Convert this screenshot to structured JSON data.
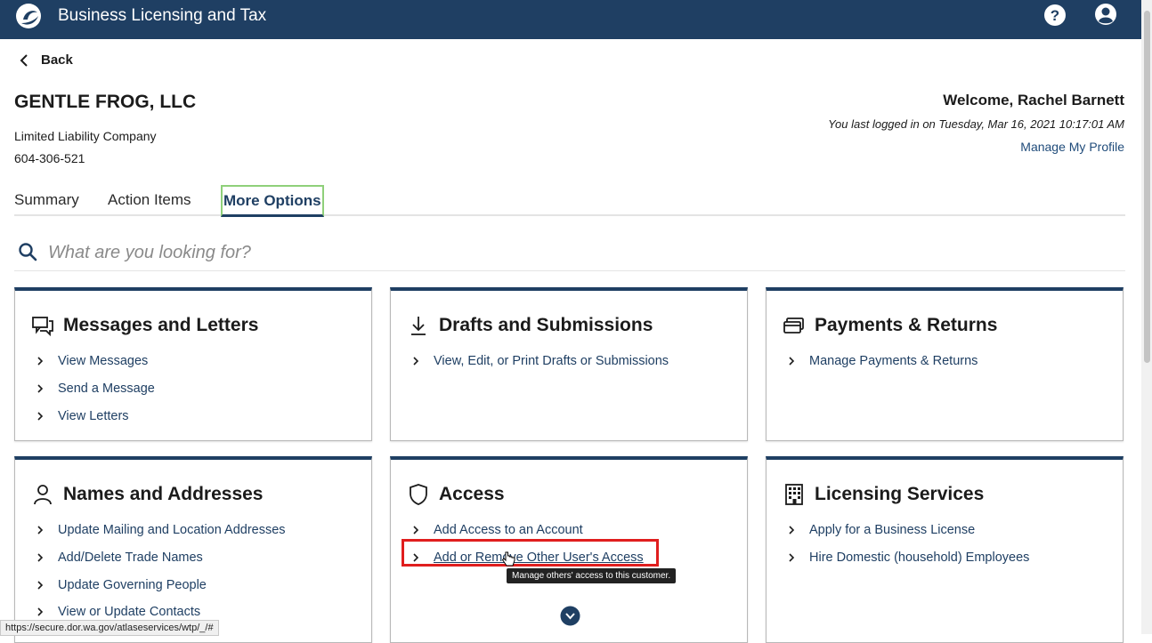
{
  "app": {
    "title": "Business Licensing and Tax"
  },
  "nav": {
    "back_label": "Back"
  },
  "business": {
    "name": "GENTLE FROG, LLC",
    "type": "Limited Liability Company",
    "id": "604-306-521"
  },
  "user": {
    "welcome": "Welcome, Rachel Barnett",
    "last_login": "You last logged in on Tuesday, Mar 16, 2021 10:17:01 AM",
    "manage_profile": "Manage My Profile"
  },
  "tabs": [
    {
      "label": "Summary",
      "active": false
    },
    {
      "label": "Action Items",
      "active": false
    },
    {
      "label": "More Options",
      "active": true
    }
  ],
  "search": {
    "placeholder": "What are you looking for?"
  },
  "cards": [
    {
      "title": "Messages and Letters",
      "icon": "messages-icon",
      "links": [
        "View Messages",
        "Send a Message",
        "View Letters"
      ]
    },
    {
      "title": "Drafts and Submissions",
      "icon": "download-icon",
      "links": [
        "View, Edit, or Print Drafts or Submissions"
      ]
    },
    {
      "title": "Payments & Returns",
      "icon": "payments-icon",
      "links": [
        "Manage Payments & Returns"
      ]
    },
    {
      "title": "Names and Addresses",
      "icon": "person-icon",
      "links": [
        "Update Mailing and Location Addresses",
        "Add/Delete Trade Names",
        "Update Governing People",
        "View or Update Contacts"
      ]
    },
    {
      "title": "Access",
      "icon": "shield-icon",
      "links": [
        "Add Access to an Account",
        "Add or Remove Other User's Access"
      ]
    },
    {
      "title": "Licensing Services",
      "icon": "building-icon",
      "links": [
        "Apply for a Business License",
        "Hire Domestic (household) Employees"
      ]
    }
  ],
  "tooltip": {
    "text": "Manage others' access to this customer."
  },
  "status_bar": {
    "url": "https://secure.dor.wa.gov/atlaseservices/wtp/_/#"
  },
  "colors": {
    "header": "#1f3f63",
    "highlight": "#e01e1e",
    "active_tab_outline": "#8fd07a",
    "link": "#1f3f63"
  }
}
